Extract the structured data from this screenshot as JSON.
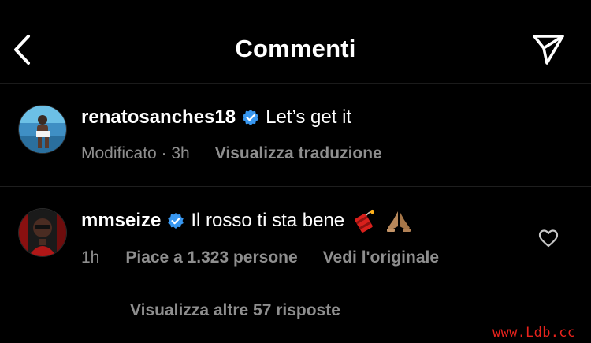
{
  "header": {
    "title": "Commenti",
    "back_icon": "chevron-left-icon",
    "share_icon": "paper-plane-icon"
  },
  "comments": [
    {
      "username": "renatosanches18",
      "verified": true,
      "text": "Let’s get it",
      "meta_status": "Modificato · 3h",
      "meta_action": "Visualizza traduzione"
    },
    {
      "username": "mmseize",
      "verified": true,
      "text": "Il rosso ti sta bene",
      "emojis": [
        "dynamite-emoji",
        "praying-hands-emoji"
      ],
      "meta_time": "1h",
      "meta_likes": "Piace a 1.323 persone",
      "meta_action": "Vedi l'originale",
      "like_icon": "heart-outline-icon"
    }
  ],
  "replies": {
    "view_more": "Visualizza altre 57 risposte"
  },
  "watermark": "www.Ldb.cc",
  "colors": {
    "background": "#000000",
    "text": "#ffffff",
    "secondary": "#8e8e8e",
    "verified": "#3897f0",
    "watermark": "#e8231d"
  }
}
